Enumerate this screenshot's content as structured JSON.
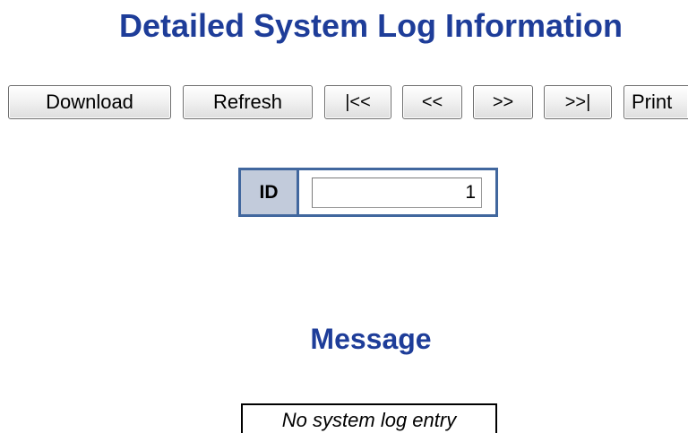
{
  "page": {
    "title": "Detailed System Log Information"
  },
  "toolbar": {
    "download_label": "Download",
    "refresh_label": "Refresh",
    "first_label": "|<<",
    "prev_label": "<<",
    "next_label": ">>",
    "last_label": ">>|",
    "print_label": "Print"
  },
  "id_field": {
    "label": "ID",
    "value": "1"
  },
  "message": {
    "heading": "Message",
    "text": "No system log entry"
  },
  "colors": {
    "heading": "#1e3d99",
    "table_border": "#41679e",
    "label_background": "#c2cbdb"
  }
}
